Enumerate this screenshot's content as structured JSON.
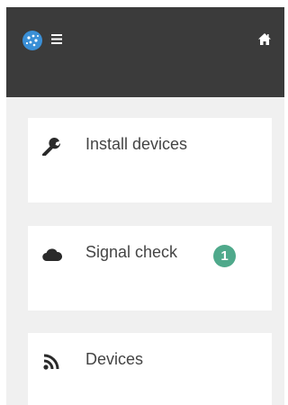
{
  "header": {
    "logo_icon": "globe-logo-icon",
    "menu_icon": "hamburger-menu-icon",
    "home_icon": "home-icon",
    "background_color": "#3b3b3b",
    "logo_color": "#3a8fd6"
  },
  "menu": {
    "items": [
      {
        "label": "Install devices",
        "icon": "wrench-icon"
      },
      {
        "label": "Signal check",
        "icon": "cloud-icon",
        "badge": "1",
        "badge_color": "#4fa98b"
      },
      {
        "label": "Devices",
        "icon": "rss-feed-icon"
      }
    ]
  }
}
